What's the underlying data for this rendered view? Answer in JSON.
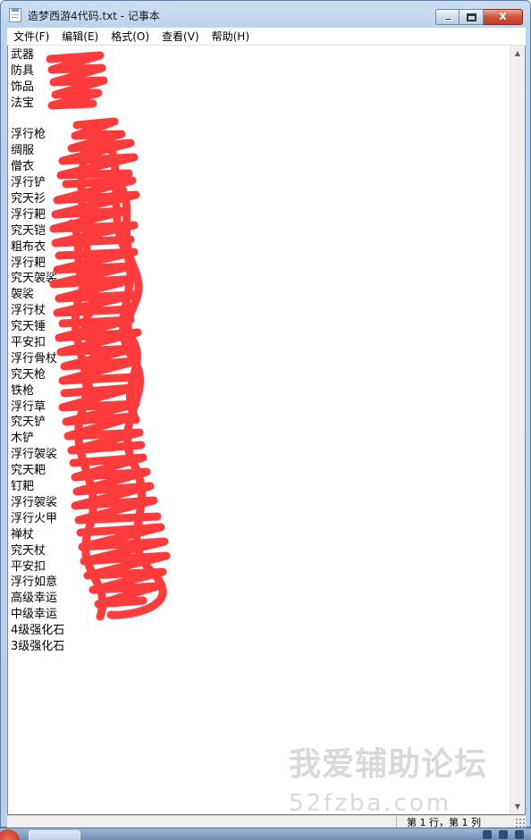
{
  "window": {
    "title": "造梦西游4代码.txt - 记事本",
    "close_glyph": "x"
  },
  "menu": [
    {
      "label": "文件(F)"
    },
    {
      "label": "编辑(E)"
    },
    {
      "label": "格式(O)"
    },
    {
      "label": "查看(V)"
    },
    {
      "label": "帮助(H)"
    }
  ],
  "document": {
    "lines": [
      "武器",
      "防具",
      "饰品",
      "法宝",
      "",
      "浮行枪",
      "绸服",
      "僧衣",
      "浮行铲",
      "究天衫",
      "浮行耙",
      "究天铠",
      "粗布衣",
      "浮行耙",
      "究天袈裟",
      "袈裟",
      "浮行杖",
      "究天锤",
      "平安扣",
      "浮行骨杖",
      "究天枪",
      "铁枪",
      "浮行草",
      "究天铲",
      "木铲",
      "浮行袈裟",
      "究天耙",
      "钉耙",
      "浮行袈裟",
      "浮行火甲",
      "禅杖",
      "究天杖",
      "平安扣",
      "浮行如意",
      "高级幸运",
      "中级幸运",
      "4级强化石",
      "3级强化石"
    ]
  },
  "statusbar": {
    "position": "第 1 行，第 1 列"
  },
  "watermark": {
    "title": "我爱辅助论坛",
    "url": "52fzba.com"
  },
  "colors": {
    "scribble": "#ff3b3b"
  }
}
